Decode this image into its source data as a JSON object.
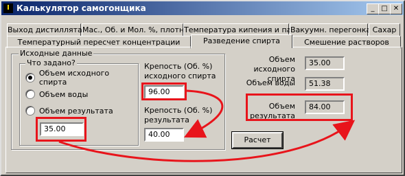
{
  "window": {
    "title": "Калькулятор самогонщика",
    "app_icon": "I",
    "minimize": "_",
    "maximize": "□",
    "close": "✕"
  },
  "tabs_row1": [
    "Выход дистиллята",
    "Мас., Об. и Мол. %, плотн.",
    "Температура кипения и пар",
    "Вакуумн. перегонка",
    "Сахар"
  ],
  "tabs_row2": [
    "Температурный пересчет концентрации",
    "Разведение спирта",
    "Смешение растворов"
  ],
  "active_tab": "Разведение спирта",
  "source_group": {
    "title": "Исходные данные",
    "question_group": {
      "title": "Что задано?",
      "options": [
        "Объем исходного спирта",
        "Объем воды",
        "Объем результата"
      ],
      "selected_index": 0
    },
    "volume_value": "35.00",
    "strength_source_label": "Крепость (Об. %) исходного спирта",
    "strength_source_value": "96.00",
    "strength_result_label": "Крепость (Об. %) результата",
    "strength_result_value": "40.00"
  },
  "results": {
    "source_volume_label": "Объем исходного спирта",
    "source_volume_value": "35.00",
    "water_volume_label": "Объем воды",
    "water_volume_value": "51.38",
    "result_volume_label": "Объем результата",
    "result_volume_value": "84.00"
  },
  "calc_button": "Расчет",
  "annotation_color": "#e8141b"
}
